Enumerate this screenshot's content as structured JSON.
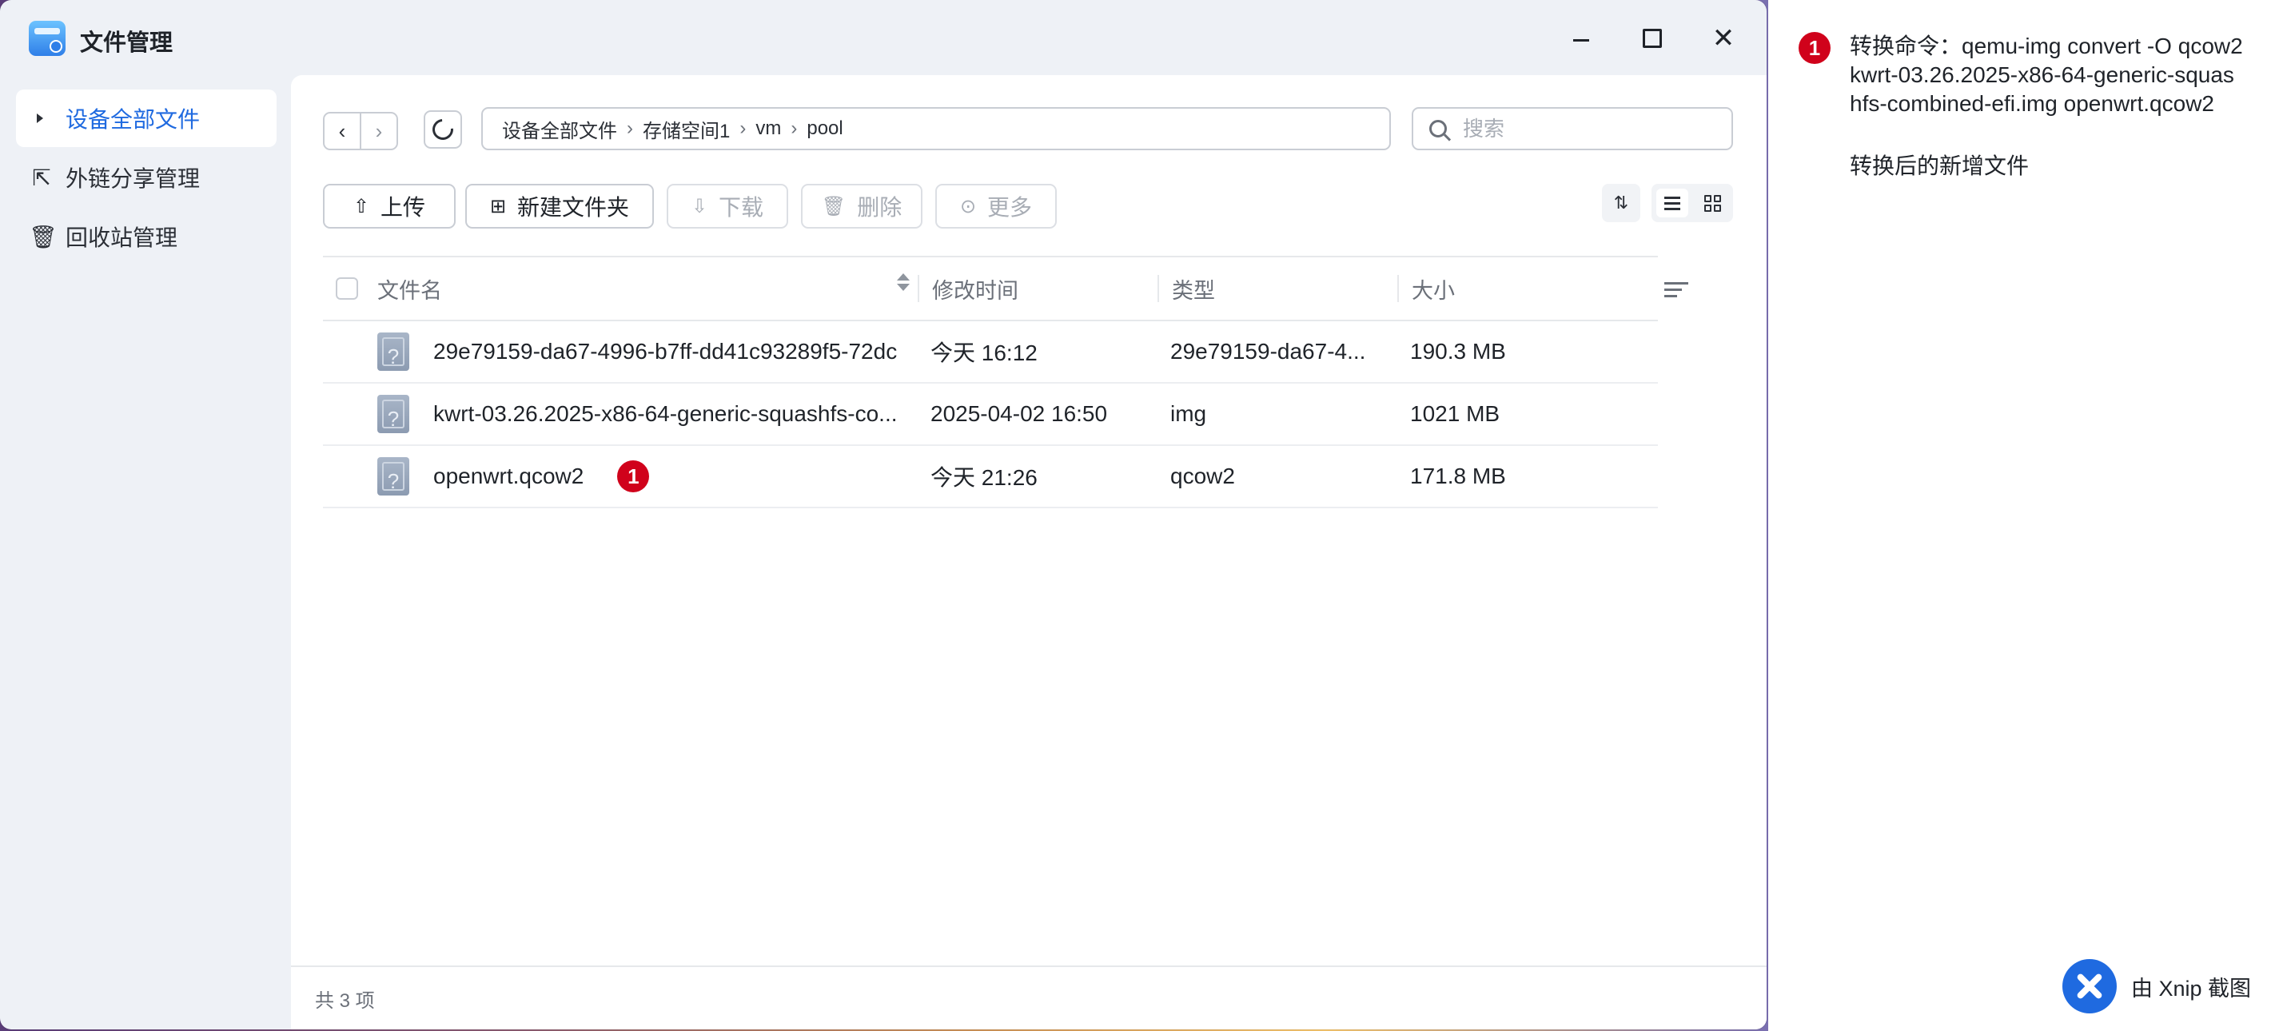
{
  "window": {
    "title": "文件管理",
    "controls": {
      "minimize": "minimize",
      "maximize": "maximize",
      "close": "✕"
    }
  },
  "sidebar": {
    "items": [
      {
        "label": "设备全部文件",
        "icon": "caret-right-icon",
        "active": true
      },
      {
        "label": "外链分享管理",
        "icon": "share-link-icon",
        "active": false
      },
      {
        "label": "回收站管理",
        "icon": "trash-icon",
        "active": false
      }
    ]
  },
  "nav": {
    "back": "‹",
    "forward": "›",
    "breadcrumb": [
      "设备全部文件",
      "存储空间1",
      "vm",
      "pool"
    ],
    "breadcrumb_sep": "›"
  },
  "search": {
    "placeholder": "搜索",
    "value": ""
  },
  "toolbar": {
    "upload": "上传",
    "new_folder": "新建文件夹",
    "download": "下载",
    "delete": "删除",
    "more": "更多"
  },
  "table": {
    "headers": {
      "name": "文件名",
      "time": "修改时间",
      "type": "类型",
      "size": "大小"
    },
    "rows": [
      {
        "name": "29e79159-da67-4996-b7ff-dd41c93289f5-72dc",
        "time": "今天 16:12",
        "type": "29e79159-da67-4...",
        "size": "190.3 MB",
        "badge": ""
      },
      {
        "name": "kwrt-03.26.2025-x86-64-generic-squashfs-co...",
        "time": "2025-04-02 16:50",
        "type": "img",
        "size": "1021 MB",
        "badge": ""
      },
      {
        "name": "openwrt.qcow2",
        "time": "今天 21:26",
        "type": "qcow2",
        "size": "171.8 MB",
        "badge": "1"
      }
    ]
  },
  "footer": {
    "count": "共 3 项"
  },
  "annotation": {
    "badge": "1",
    "command": "转换命令：qemu-img convert -O qcow2 kwrt-03.26.2025-x86-64-generic-squashfs-combined-efi.img openwrt.qcow2",
    "note": "转换后的新增文件"
  },
  "watermark": {
    "text": "由 Xnip 截图"
  },
  "colors": {
    "accent": "#1f6ae0",
    "badge": "#d0021b",
    "sidebar_bg": "#eef1f6"
  }
}
